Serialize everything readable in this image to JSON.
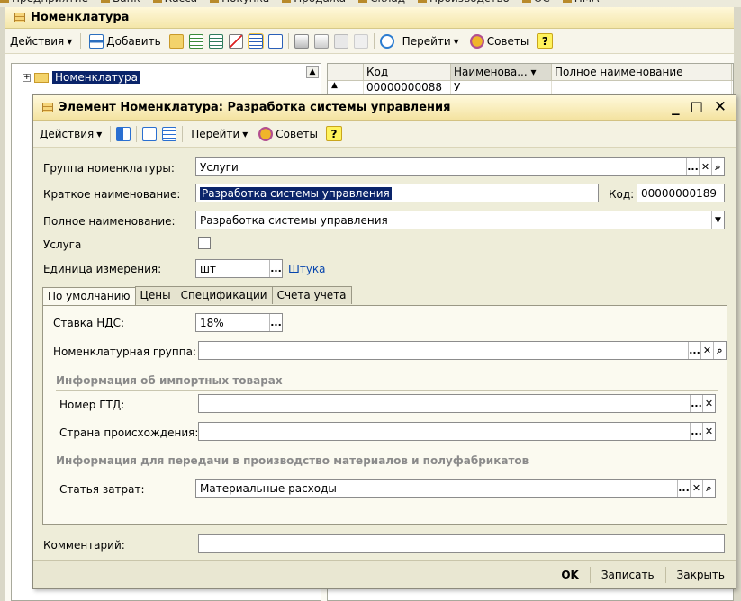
{
  "top_menu": [
    "Предприятие",
    "Банк",
    "Касса",
    "Покупка",
    "Продажа",
    "Склад",
    "Производство",
    "ОС",
    "НМА"
  ],
  "main_window": {
    "title": "Номенклатура",
    "toolbar": {
      "actions_label": "Действия",
      "add_label": "Добавить",
      "goto_label": "Перейти",
      "tips_label": "Советы",
      "help_label": "?"
    },
    "tree": {
      "root_label": "Номенклатура",
      "expand_glyph": "+"
    },
    "grid": {
      "columns": [
        "Код",
        "Наименова...",
        "Полное наименование"
      ],
      "first_row_code": "00000000088",
      "first_row_name": "У"
    }
  },
  "dialog": {
    "title": "Элемент Номенклатура: Разработка системы управления",
    "controls": {
      "minimize": "_",
      "maximize": "□",
      "close": "✕"
    },
    "toolbar": {
      "actions_label": "Действия",
      "goto_label": "Перейти",
      "tips_label": "Советы",
      "help_label": "?"
    },
    "fields": {
      "group_label": "Группа номенклатуры:",
      "group_value": "Услуги",
      "short_name_label": "Краткое наименование:",
      "short_name_value": "Разработка системы управления",
      "code_label": "Код:",
      "code_value": "00000000189",
      "full_name_label": "Полное наименование:",
      "full_name_value": "Разработка системы управления",
      "service_label": "Услуга",
      "service_checked": false,
      "unit_label": "Единица измерения:",
      "unit_value": "шт",
      "unit_link": "Штука"
    },
    "tabs": [
      "По умолчанию",
      "Цены",
      "Спецификации",
      "Счета учета"
    ],
    "active_tab": "По умолчанию",
    "defaults_tab": {
      "vat_label": "Ставка НДС:",
      "vat_value": "18%",
      "nom_group_label": "Номенклатурная группа:",
      "nom_group_value": "",
      "import_section": "Информация об импортных товарах",
      "gtd_label": "Номер ГТД:",
      "gtd_value": "",
      "country_label": "Страна происхождения:",
      "country_value": "",
      "production_section": "Информация для передачи в производство материалов и полуфабрикатов",
      "cost_item_label": "Статья затрат:",
      "cost_item_value": "Материальные расходы"
    },
    "comment_label": "Комментарий:",
    "comment_value": "",
    "buttons": {
      "ok": "OK",
      "save": "Записать",
      "close": "Закрыть"
    }
  },
  "colors": {
    "selection": "#0a246a",
    "title_gradient_top": "#fff9dc",
    "title_gradient_bottom": "#f4e3a1",
    "dialog_bg": "#eeedd9",
    "link": "#0645ad"
  }
}
